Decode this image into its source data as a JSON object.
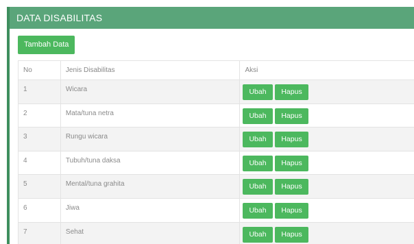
{
  "panel": {
    "title": "DATA DISABILITAS"
  },
  "toolbar": {
    "add_label": "Tambah Data"
  },
  "table": {
    "headers": {
      "no": "No",
      "jenis": "Jenis Disabilitas",
      "aksi": "Aksi"
    },
    "edit_label": "Ubah",
    "delete_label": "Hapus",
    "rows": [
      {
        "no": "1",
        "jenis": "Wicara"
      },
      {
        "no": "2",
        "jenis": "Mata/tuna netra"
      },
      {
        "no": "3",
        "jenis": "Rungu wicara"
      },
      {
        "no": "4",
        "jenis": "Tubuh/tuna daksa"
      },
      {
        "no": "5",
        "jenis": "Mental/tuna grahita"
      },
      {
        "no": "6",
        "jenis": "Jiwa"
      },
      {
        "no": "7",
        "jenis": "Sehat"
      }
    ]
  },
  "colors": {
    "header": "#5aa57a",
    "button": "#4cb85e",
    "border": "#3e8e5e"
  }
}
